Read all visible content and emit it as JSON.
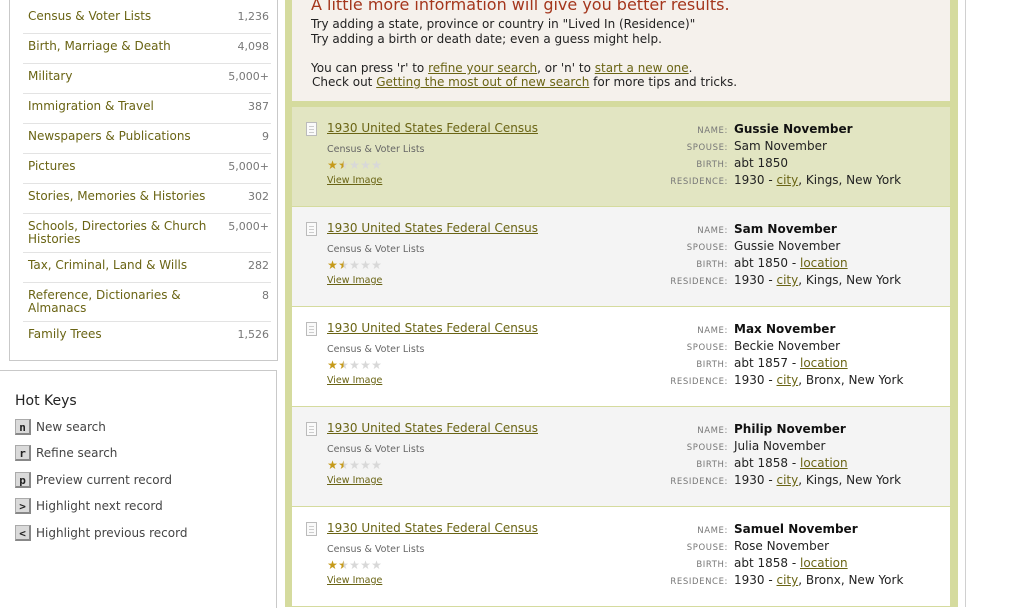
{
  "categories": [
    {
      "name": "Census & Voter Lists",
      "count": "1,236"
    },
    {
      "name": "Birth, Marriage & Death",
      "count": "4,098"
    },
    {
      "name": "Military",
      "count": "5,000+"
    },
    {
      "name": "Immigration & Travel",
      "count": "387"
    },
    {
      "name": "Newspapers & Publications",
      "count": "9"
    },
    {
      "name": "Pictures",
      "count": "5,000+"
    },
    {
      "name": "Stories, Memories & Histories",
      "count": "302"
    },
    {
      "name": "Schools, Directories & Church Histories",
      "count": "5,000+"
    },
    {
      "name": "Tax, Criminal, Land & Wills",
      "count": "282"
    },
    {
      "name": "Reference, Dictionaries & Almanacs",
      "count": "8"
    },
    {
      "name": "Family Trees",
      "count": "1,526"
    }
  ],
  "hotkeys": {
    "title": "Hot Keys",
    "items": [
      {
        "key": "n",
        "label": "New search"
      },
      {
        "key": "r",
        "label": "Refine search"
      },
      {
        "key": "p",
        "label": "Preview current record"
      },
      {
        "key": ">",
        "label": "Highlight next record"
      },
      {
        "key": "<",
        "label": "Highlight previous record"
      }
    ]
  },
  "info": {
    "headline": "A little more information will give you better results.",
    "tip1": "Try adding a state, province or country in \"Lived In (Residence)\"",
    "tip2": "Try adding a birth or death date; even a guess might help.",
    "press_pre": "You can press 'r' to ",
    "refine_link": "refine your search",
    "press_mid": ", or 'n' to ",
    "new_link": "start a new one",
    "press_post": ".",
    "checkout_pre": "Check out ",
    "checkout_link": "Getting the most out of new search",
    "checkout_post": " for more tips and tricks."
  },
  "labels": {
    "name": "NAME:",
    "spouse": "SPOUSE:",
    "birth": "BIRTH:",
    "residence": "RESIDENCE:"
  },
  "records": [
    {
      "title": "1930 United States Federal Census",
      "collection": "Census & Voter Lists",
      "view": "View Image",
      "rating": 1.5,
      "name": "Gussie November",
      "spouse": "Sam November",
      "birth": "abt 1850",
      "birth_link": "",
      "res_pre": "1930 - ",
      "res_link": "city",
      "res_post": ", Kings, New York",
      "highlight": true
    },
    {
      "title": "1930 United States Federal Census",
      "collection": "Census & Voter Lists",
      "view": "View Image",
      "rating": 1.5,
      "name": "Sam November",
      "spouse": "Gussie November",
      "birth": "abt 1850 - ",
      "birth_link": "location",
      "res_pre": "1930 - ",
      "res_link": "city",
      "res_post": ", Kings, New York",
      "highlight": false
    },
    {
      "title": "1930 United States Federal Census",
      "collection": "Census & Voter Lists",
      "view": "View Image",
      "rating": 1.5,
      "name": "Max November",
      "spouse": "Beckie November",
      "birth": "abt 1857 - ",
      "birth_link": "location",
      "res_pre": "1930 - ",
      "res_link": "city",
      "res_post": ", Bronx, New York",
      "highlight": false
    },
    {
      "title": "1930 United States Federal Census",
      "collection": "Census & Voter Lists",
      "view": "View Image",
      "rating": 1.5,
      "name": "Philip November",
      "spouse": "Julia November",
      "birth": "abt 1858 - ",
      "birth_link": "location",
      "res_pre": "1930 - ",
      "res_link": "city",
      "res_post": ", Kings, New York",
      "highlight": false
    },
    {
      "title": "1930 United States Federal Census",
      "collection": "Census & Voter Lists",
      "view": "View Image",
      "rating": 1.5,
      "name": "Samuel November",
      "spouse": "Rose November",
      "birth": "abt 1858 - ",
      "birth_link": "location",
      "res_pre": "1930 - ",
      "res_link": "city",
      "res_post": ", Bronx, New York",
      "highlight": false
    }
  ],
  "colors": {
    "highlight_row": "#e2e5c2",
    "alt_row": "#f4f4f4",
    "white_row": "#ffffff",
    "link": "#6a6414",
    "headline": "#a4361c",
    "frame": "#d5db9e",
    "star": "#c59a1a"
  }
}
